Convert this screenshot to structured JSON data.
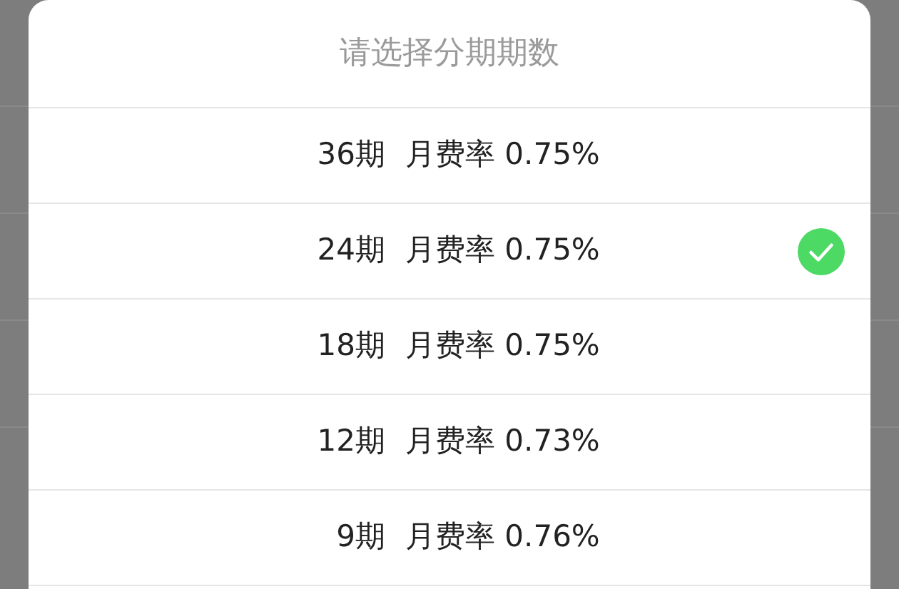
{
  "dialog": {
    "title": "请选择分期期数",
    "options": [
      {
        "term": "36期",
        "rate": "月费率 0.75%",
        "selected": false
      },
      {
        "term": "24期",
        "rate": "月费率 0.75%",
        "selected": true
      },
      {
        "term": "18期",
        "rate": "月费率 0.75%",
        "selected": false
      },
      {
        "term": "12期",
        "rate": "月费率 0.73%",
        "selected": false
      },
      {
        "term": "9期",
        "rate": "月费率 0.76%",
        "selected": false
      }
    ]
  }
}
